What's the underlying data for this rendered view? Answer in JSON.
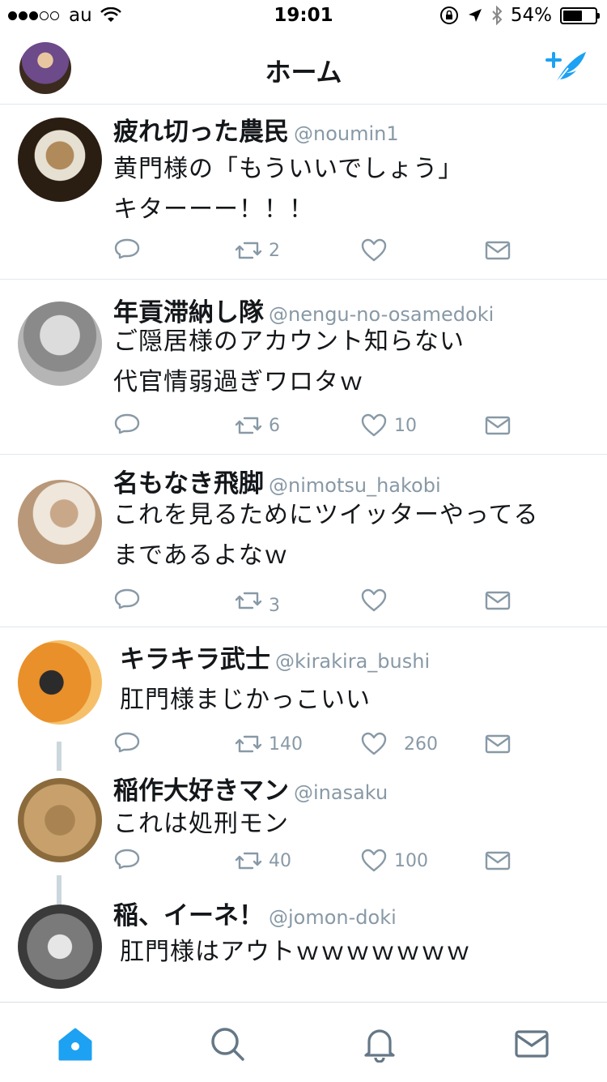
{
  "status_bar": {
    "carrier": "au",
    "time": "19:01",
    "battery": "54%"
  },
  "header": {
    "title": "ホーム"
  },
  "colors": {
    "accent": "#1da1f2",
    "icon_gray": "#8899a6",
    "divider": "#e1e8ed"
  },
  "tweets": [
    {
      "name": "疲れ切った農民",
      "handle": "@noumin1",
      "lines": [
        "黄門様の「もういいでしょう」",
        "キターーー！！！"
      ],
      "retweets": "2",
      "likes": ""
    },
    {
      "name": "年貢滞納し隊",
      "handle": "@nengu-no-osamedoki",
      "lines": [
        "ご隠居様のアカウント知らない",
        "代官情弱過ぎワロタｗ"
      ],
      "retweets": "6",
      "likes": "10"
    },
    {
      "name": "名もなき飛脚",
      "handle": "@nimotsu_hakobi",
      "lines": [
        "これを見るためにツイッターやってる",
        "まであるよなｗ"
      ],
      "retweets": "3",
      "likes": ""
    },
    {
      "name": "キラキラ武士",
      "handle": "@kirakira_bushi",
      "lines": [
        "肛門様まじかっこいい"
      ],
      "retweets": "140",
      "likes": "260"
    },
    {
      "name": "稲作大好きマン",
      "handle": "@inasaku",
      "lines": [
        "これは処刑モン"
      ],
      "retweets": "40",
      "likes": "100"
    },
    {
      "name": "稲、イーネ！",
      "handle": "@jomon-doki",
      "lines": [
        "肛門様はアウトｗｗｗｗｗｗｗ"
      ],
      "retweets": "",
      "likes": ""
    }
  ],
  "tabbar": {
    "icons": [
      "home-icon",
      "search-icon",
      "notifications-icon",
      "messages-icon"
    ]
  }
}
